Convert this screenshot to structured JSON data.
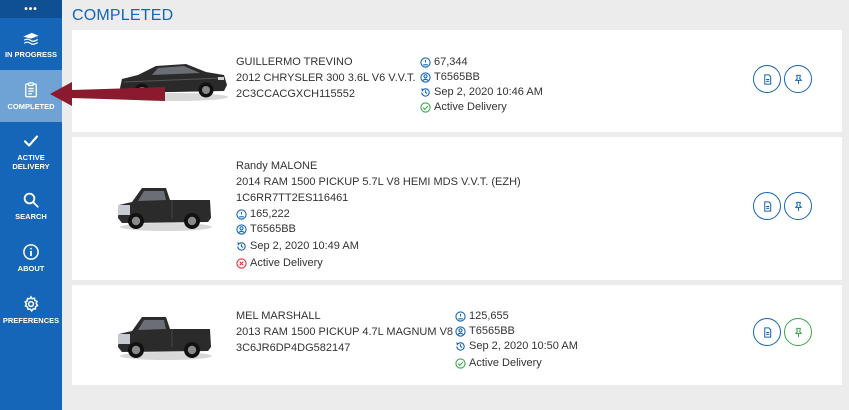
{
  "sidebar": {
    "menu_dots": "•••",
    "items": [
      {
        "label": "IN PROGRESS",
        "icon": "car-ship-icon"
      },
      {
        "label": "COMPLETED",
        "icon": "clipboard-icon"
      },
      {
        "label_line1": "ACTIVE",
        "label_line2": "DELIVERY",
        "icon": "checkmark-icon"
      },
      {
        "label": "SEARCH",
        "icon": "search-icon"
      },
      {
        "label": "ABOUT",
        "icon": "info-icon"
      },
      {
        "label": "PREFERENCES",
        "icon": "gear-icon"
      }
    ]
  },
  "page": {
    "title": "COMPLETED"
  },
  "colors": {
    "primary": "#1565b8",
    "active_sidebar": "#6fa3d6",
    "success": "#3aa84a",
    "error": "#d9333f",
    "arrow": "#8b1a2e"
  },
  "records": [
    {
      "name": "GUILLERMO TREVINO",
      "vehicle": "2012 CHRYSLER 300 3.6L V6 V.V.T.",
      "vin": "2C3CCACGXCH115552",
      "mileage": "67,344",
      "user": "T6565BB",
      "datetime": "Sep 2, 2020 10:46 AM",
      "status": "Active Delivery",
      "status_state": "success"
    },
    {
      "name": "Randy MALONE",
      "vehicle": "2014 RAM 1500 PICKUP 5.7L V8 HEMI MDS V.V.T. (EZH)",
      "vin": "1C6RR7TT2ES116461",
      "mileage": "165,222",
      "user": "T6565BB",
      "datetime": "Sep 2, 2020 10:49 AM",
      "status": "Active Delivery",
      "status_state": "error"
    },
    {
      "name": "MEL MARSHALL",
      "vehicle": "2013 RAM 1500 PICKUP 4.7L MAGNUM V8",
      "vin": "3C6JR6DP4DG582147",
      "mileage": "125,655",
      "user": "T6565BB",
      "datetime": "Sep 2, 2020 10:50 AM",
      "status": "Active Delivery",
      "status_state": "success"
    }
  ]
}
